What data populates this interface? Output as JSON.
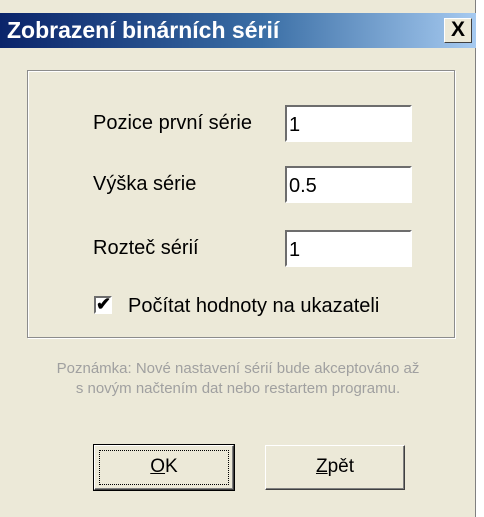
{
  "window": {
    "title": "Zobrazení binárních sérií",
    "close_glyph": "X"
  },
  "form": {
    "fields": [
      {
        "label": "Pozice první série",
        "value": "1"
      },
      {
        "label": "Výška série",
        "value": "0.5"
      },
      {
        "label": "Rozteč sérií",
        "value": "1"
      }
    ],
    "checkbox": {
      "label": "Počítat hodnoty na ukazateli",
      "checked": true
    }
  },
  "note": {
    "line1": "Poznámka: Nové nastavení sérií bude akceptováno až",
    "line2": "s novým načtením dat nebo restartem programu."
  },
  "buttons": {
    "ok": {
      "mnemonic": "O",
      "rest": "K"
    },
    "back": {
      "mnemonic": "Z",
      "rest": "pět"
    }
  }
}
